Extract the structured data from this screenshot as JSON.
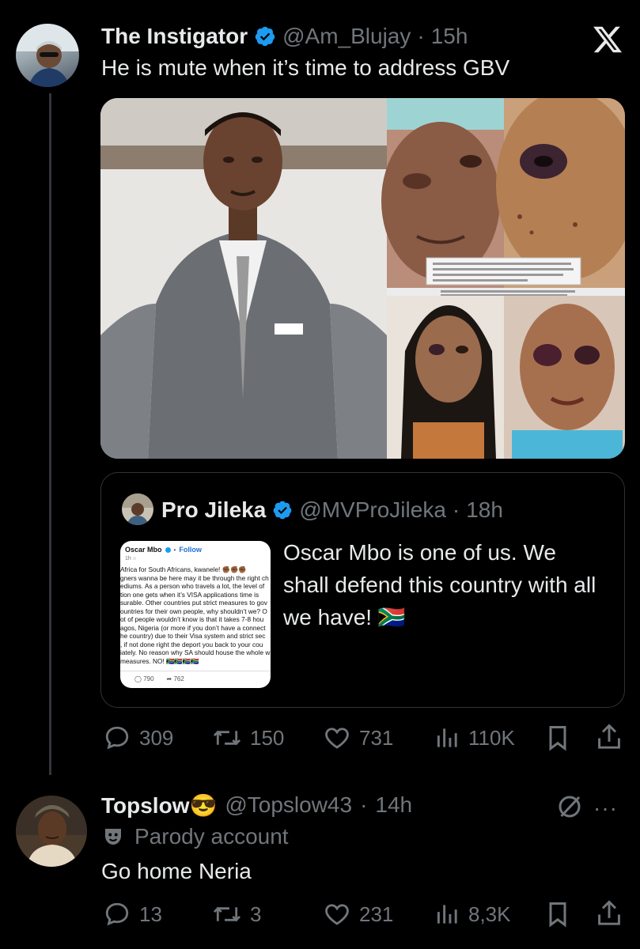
{
  "tweet": {
    "author_name": "The Instigator",
    "handle": "@Am_Blujay",
    "time": "15h",
    "text": "He is mute when it’s time to address GBV",
    "close_icon": "x-logo-icon",
    "stats": {
      "replies": "309",
      "retweets": "150",
      "likes": "731",
      "views": "110K"
    }
  },
  "quote": {
    "author_name": "Pro Jileka",
    "handle": "@MVProJileka",
    "time": "18h",
    "text": "Oscar Mbo is one of us. We shall defend this country with all we have! 🇿🇦",
    "screenshot": {
      "name": "Oscar Mbo",
      "follow": "Follow",
      "time": "1h",
      "lines": [
        "Africa for South Africans, kwanele! ✊🏾✊🏾✊🏾",
        "gners wanna be here may it be through the right ch",
        "ediums. As a person who travels a lot, the level of",
        "tion one gets when it’s VISA applications time is",
        "surable. Other countries put strict measures to gov",
        "ountries for their own people, why shouldn’t we? O",
        "ot of people wouldn’t know is that it takes 7-8 hou",
        "agos, Nigeria (or more if you don’t have a connect",
        "he country) due to their Visa system and strict sec",
        ", if not done right the deport you back to your cou",
        "iately. No reason why SA should house the whole w",
        "measures. NO! 🇿🇦🇿🇦🇿🇦🇿🇦"
      ],
      "replies": "790",
      "shares": "762"
    }
  },
  "reply": {
    "author_name": "Topslow😎",
    "handle": "@Topslow43",
    "time": "14h",
    "parody_label": "Parody account",
    "text": "Go home Neria",
    "stats": {
      "replies": "13",
      "retweets": "3",
      "likes": "231",
      "views": "8,3K"
    }
  },
  "colors": {
    "background": "#000000",
    "text": "#e7e9ea",
    "muted": "#71767b",
    "verified": "#1d9bf0",
    "border": "#2f3336"
  }
}
